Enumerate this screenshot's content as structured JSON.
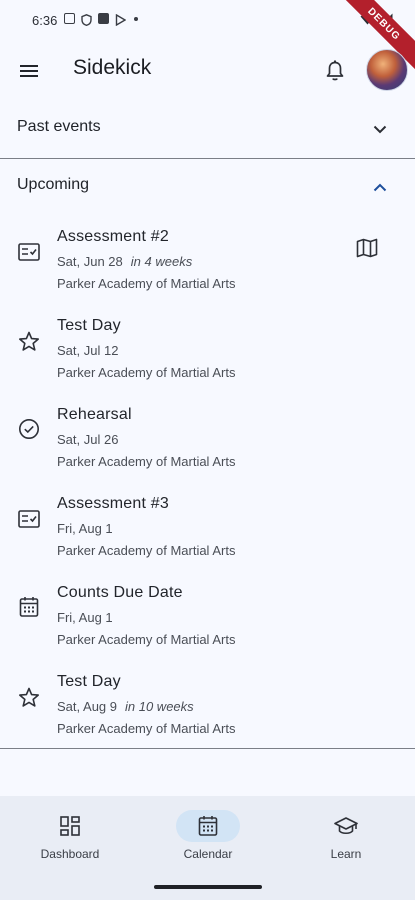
{
  "status_bar": {
    "time": "6:36",
    "debug_label": "DEBUG"
  },
  "app_bar": {
    "title": "Sidekick"
  },
  "past_section": {
    "label": "Past events"
  },
  "upcoming_section": {
    "label": "Upcoming"
  },
  "events": [
    {
      "title": "Assessment #2",
      "date": "Sat, Jun 28",
      "relative": "in 4 weeks",
      "location": "Parker Academy of Martial Arts",
      "icon": "checklist-icon"
    },
    {
      "title": "Test Day",
      "date": "Sat, Jul 12",
      "relative": "",
      "location": "Parker Academy of Martial Arts",
      "icon": "star-icon"
    },
    {
      "title": "Rehearsal",
      "date": "Sat, Jul 26",
      "relative": "",
      "location": "Parker Academy of Martial Arts",
      "icon": "check-circle-icon"
    },
    {
      "title": "Assessment #3",
      "date": "Fri, Aug 1",
      "relative": "",
      "location": "Parker Academy of Martial Arts",
      "icon": "checklist-icon"
    },
    {
      "title": "Counts Due Date",
      "date": "Fri, Aug 1",
      "relative": "",
      "location": "Parker Academy of Martial Arts",
      "icon": "calendar-icon"
    },
    {
      "title": "Test Day",
      "date": "Sat, Aug 9",
      "relative": "in 10 weeks",
      "location": "Parker Academy of Martial Arts",
      "icon": "star-icon"
    }
  ],
  "bottom_nav": {
    "items": [
      {
        "label": "Dashboard",
        "icon": "dashboard-icon",
        "active": false
      },
      {
        "label": "Calendar",
        "icon": "calendar-icon",
        "active": true
      },
      {
        "label": "Learn",
        "icon": "graduation-cap-icon",
        "active": false
      }
    ]
  },
  "colors": {
    "background": "#f7f9ff",
    "nav_background": "#e9edf5",
    "active_pill": "#d2e4f5"
  }
}
